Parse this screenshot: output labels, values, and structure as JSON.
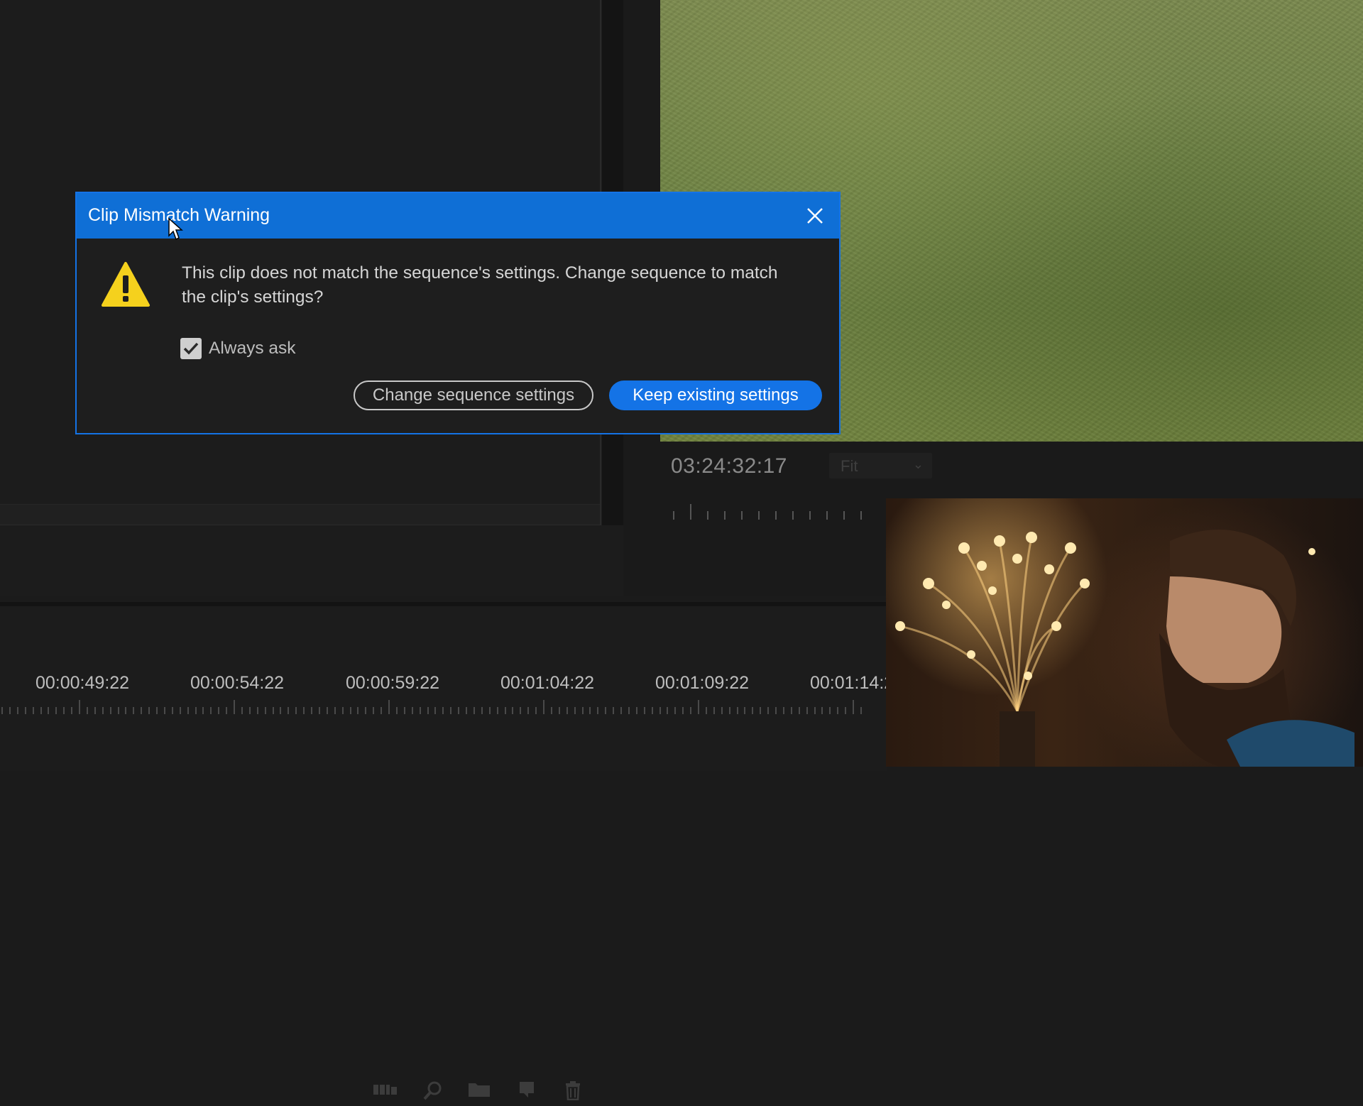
{
  "dialog": {
    "title": "Clip Mismatch Warning",
    "message": "This clip does not match the sequence's settings. Change sequence to match the clip's settings?",
    "checkbox_label": "Always ask",
    "checkbox_checked": true,
    "change_button_label": "Change sequence settings",
    "keep_button_label": "Keep existing settings",
    "close_icon": "close-icon",
    "warning_icon": "warning-triangle-icon"
  },
  "program_monitor": {
    "timecode": "03:24:32:17",
    "zoom_value": "Fit"
  },
  "project_toolbar": {
    "icons": [
      "metadata-display-icon",
      "search-icon",
      "new-bin-icon",
      "new-item-icon",
      "trash-icon"
    ]
  },
  "timeline": {
    "time_labels": [
      "00:00:49:22",
      "00:00:54:22",
      "00:00:59:22",
      "00:01:04:22",
      "00:01:09:22",
      "00:01:14:2"
    ]
  },
  "colors": {
    "accent": "#1473e6",
    "titlebar": "#0f6fd6",
    "warning": "#f5d11d"
  }
}
